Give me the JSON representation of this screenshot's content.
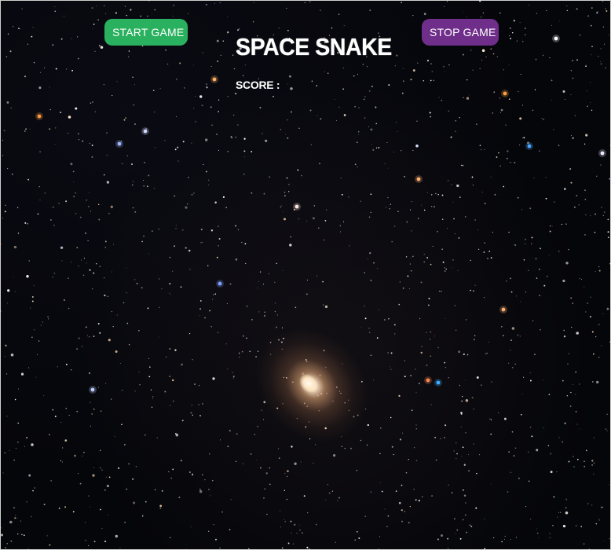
{
  "game": {
    "title": "SPACE SNAKE",
    "score_label": "SCORE :",
    "score_value": ""
  },
  "controls": {
    "start_label": "START GAME",
    "stop_label": "STOP GAME",
    "start_color": "#2ab15f",
    "stop_color": "#6f2e8a"
  },
  "background": {
    "scene": "starfield-with-galaxy",
    "base_color": "#05060a"
  }
}
